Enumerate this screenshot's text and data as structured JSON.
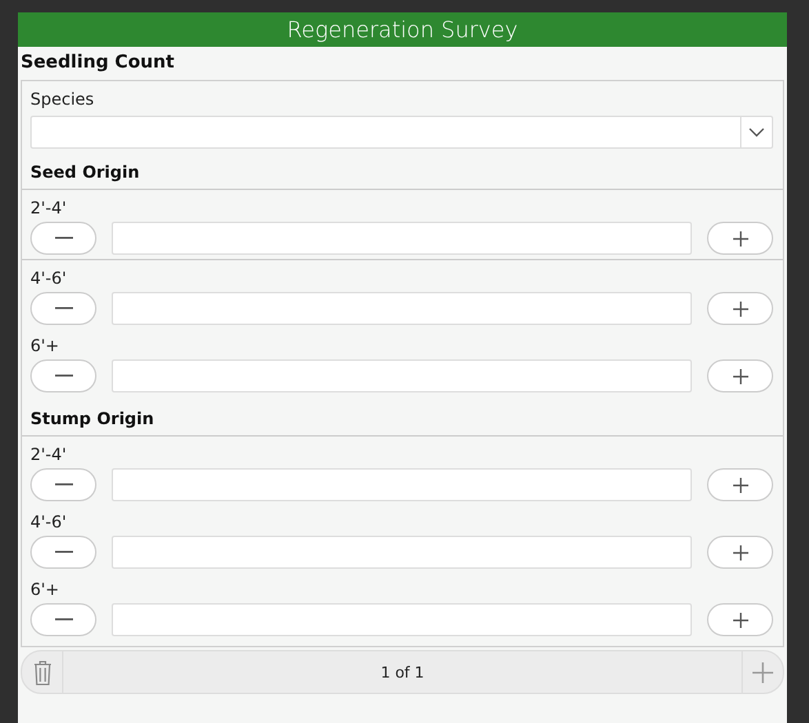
{
  "header": {
    "title": "Regeneration Survey"
  },
  "section": {
    "title": "Seedling Count",
    "species": {
      "label": "Species"
    },
    "groups": [
      {
        "title": "Seed Origin",
        "rows": [
          {
            "label": "2'-4'",
            "divider_below": true
          },
          {
            "label": "4'-6'",
            "divider_below": false
          },
          {
            "label": "6'+",
            "divider_below": false
          }
        ]
      },
      {
        "title": "Stump Origin",
        "rows": [
          {
            "label": "2'-4'",
            "divider_below": false
          },
          {
            "label": "4'-6'",
            "divider_below": false
          },
          {
            "label": "6'+",
            "divider_below": false
          }
        ]
      }
    ]
  },
  "pager": {
    "text": "1 of 1"
  }
}
